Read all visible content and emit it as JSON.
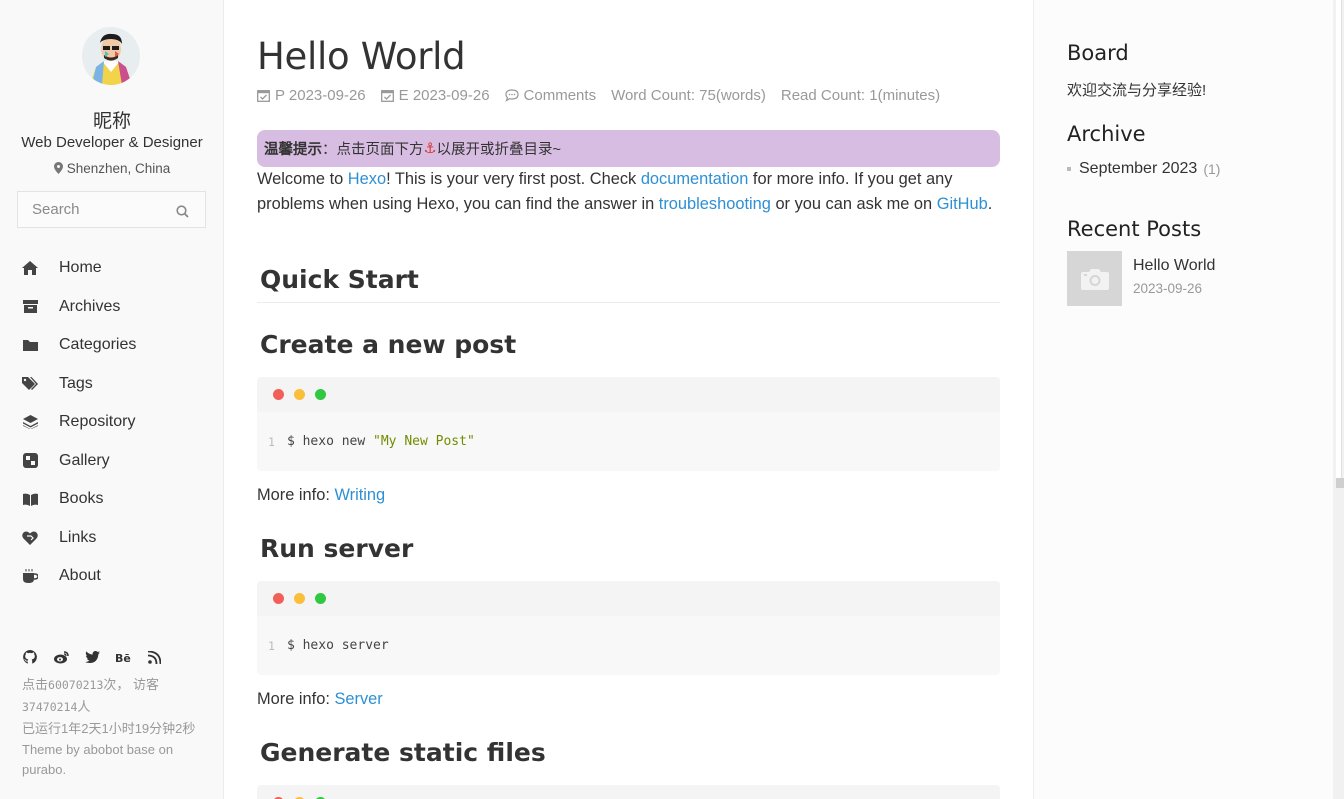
{
  "profile": {
    "nickname": "昵称",
    "role": "Web Developer & Designer",
    "location": "Shenzhen, China"
  },
  "search": {
    "placeholder": "Search"
  },
  "nav": {
    "items": [
      {
        "label": "Home",
        "icon": "home-icon"
      },
      {
        "label": "Archives",
        "icon": "archive-icon"
      },
      {
        "label": "Categories",
        "icon": "folder-icon"
      },
      {
        "label": "Tags",
        "icon": "tags-icon"
      },
      {
        "label": "Repository",
        "icon": "layers-icon"
      },
      {
        "label": "Gallery",
        "icon": "gallery-icon"
      },
      {
        "label": "Books",
        "icon": "book-icon"
      },
      {
        "label": "Links",
        "icon": "heart-link-icon"
      },
      {
        "label": "About",
        "icon": "coffee-icon"
      }
    ]
  },
  "socials": [
    "github-icon",
    "weibo-icon",
    "twitter-icon",
    "behance-icon",
    "rss-icon"
  ],
  "footer": {
    "visits_prefix": "点击",
    "visits_count": "60070213",
    "visits_mid": "次， 访客",
    "visitors_count": "37470214",
    "visitors_suffix": "人",
    "uptime": "已运行1年2天1小时19分钟2秒",
    "theme": "Theme by abobot base on purabo."
  },
  "post": {
    "title": "Hello World",
    "meta": {
      "published": "P 2023-09-26",
      "edited": "E 2023-09-26",
      "comments": "Comments",
      "word_count": "Word Count: 75(words)",
      "read_count": "Read Count: 1(minutes)"
    },
    "tip": {
      "bold": "温馨提示",
      "text1": "：点击页面下方",
      "anchor": "⚓",
      "text2": "以展开或折叠目录~"
    },
    "intro": {
      "t1": "Welcome to ",
      "l1": "Hexo",
      "t2": "! This is your very first post. Check ",
      "l2": "documentation",
      "t3": " for more info. If you get any problems when using Hexo, you can find the answer in ",
      "l3": "troubleshooting",
      "t4": " or you can ask me on ",
      "l4": "GitHub",
      "t5": "."
    },
    "h_quick": "Quick Start",
    "h_create": "Create a new post",
    "code1": {
      "ln": "1",
      "cmd": "$ hexo new ",
      "str": "\"My New Post\""
    },
    "more1": {
      "label": "More info: ",
      "link": "Writing"
    },
    "h_run": "Run server",
    "code2": {
      "ln": "1",
      "cmd": "$ hexo server"
    },
    "more2": {
      "label": "More info: ",
      "link": "Server"
    },
    "h_generate": "Generate static files"
  },
  "sidebar_right": {
    "board_title": "Board",
    "board_text": "欢迎交流与分享经验!",
    "archive_title": "Archive",
    "archive_item": "September 2023",
    "archive_count": "(1)",
    "recent_title": "Recent Posts",
    "recent_post_title": "Hello World",
    "recent_post_date": "2023-09-26"
  },
  "colors": {
    "link": "#2e90d4",
    "tip_bg": "#d8bde2",
    "dot_red": "#f25f58",
    "dot_yellow": "#fbbe3b",
    "dot_green": "#2fc840"
  }
}
